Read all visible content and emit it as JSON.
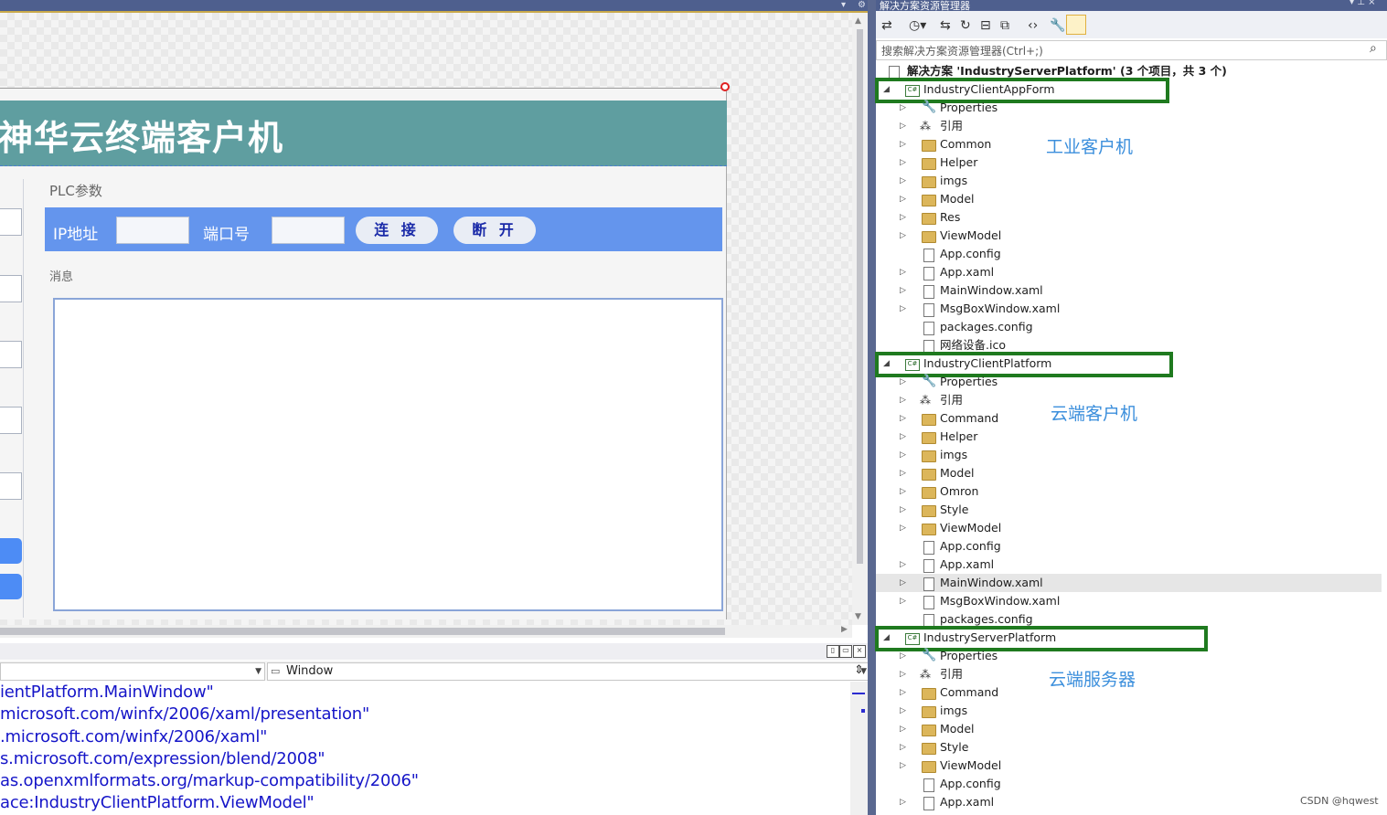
{
  "designer": {
    "app_title": "神华云终端客户机",
    "plc_label": "PLC参数",
    "ip_label": "IP地址",
    "port_label": "端口号",
    "connect_button": "连 接",
    "disconnect_button": "断 开",
    "message_label": "消息"
  },
  "xaml_pane": {
    "element_combo": "Window",
    "lines": [
      "ientPlatform.MainWindow\"",
      "microsoft.com/winfx/2006/xaml/presentation\"",
      ".microsoft.com/winfx/2006/xaml\"",
      "s.microsoft.com/expression/blend/2008\"",
      "as.openxmlformats.org/markup-compatibility/2006\"",
      "ace:IndustryClientPlatform.ViewModel\""
    ]
  },
  "solution_explorer": {
    "title": "解决方案资源管理器",
    "search_placeholder": "搜索解决方案资源管理器(Ctrl+;)",
    "solution_label": "解决方案 'IndustryServerPlatform' (3 个项目，共 3 个)",
    "projects": [
      {
        "name": "IndustryClientAppForm",
        "annotation": "工业客户机",
        "items": [
          {
            "label": "Properties",
            "icon": "wrench-icon"
          },
          {
            "label": "引用",
            "icon": "references-icon"
          },
          {
            "label": "Common",
            "icon": "folder-icon"
          },
          {
            "label": "Helper",
            "icon": "folder-icon"
          },
          {
            "label": "imgs",
            "icon": "folder-icon"
          },
          {
            "label": "Model",
            "icon": "folder-icon"
          },
          {
            "label": "Res",
            "icon": "folder-icon"
          },
          {
            "label": "ViewModel",
            "icon": "folder-icon"
          },
          {
            "label": "App.config",
            "icon": "config-file-icon"
          },
          {
            "label": "App.xaml",
            "icon": "xaml-file-icon"
          },
          {
            "label": "MainWindow.xaml",
            "icon": "xaml-file-icon"
          },
          {
            "label": "MsgBoxWindow.xaml",
            "icon": "xaml-file-icon"
          },
          {
            "label": "packages.config",
            "icon": "config-file-icon"
          },
          {
            "label": "网络设备.ico",
            "icon": "ico-file-icon"
          }
        ]
      },
      {
        "name": "IndustryClientPlatform",
        "annotation": "云端客户机",
        "items": [
          {
            "label": "Properties",
            "icon": "wrench-icon"
          },
          {
            "label": "引用",
            "icon": "references-icon"
          },
          {
            "label": "Command",
            "icon": "folder-icon"
          },
          {
            "label": "Helper",
            "icon": "folder-icon"
          },
          {
            "label": "imgs",
            "icon": "folder-icon"
          },
          {
            "label": "Model",
            "icon": "folder-icon"
          },
          {
            "label": "Omron",
            "icon": "folder-icon"
          },
          {
            "label": "Style",
            "icon": "folder-icon"
          },
          {
            "label": "ViewModel",
            "icon": "folder-icon"
          },
          {
            "label": "App.config",
            "icon": "config-file-icon"
          },
          {
            "label": "App.xaml",
            "icon": "xaml-file-icon"
          },
          {
            "label": "MainWindow.xaml",
            "icon": "xaml-file-icon"
          },
          {
            "label": "MsgBoxWindow.xaml",
            "icon": "xaml-file-icon"
          },
          {
            "label": "packages.config",
            "icon": "config-file-icon"
          }
        ]
      },
      {
        "name": "IndustryServerPlatform",
        "annotation": "云端服务器",
        "items": [
          {
            "label": "Properties",
            "icon": "wrench-icon"
          },
          {
            "label": "引用",
            "icon": "references-icon"
          },
          {
            "label": "Command",
            "icon": "folder-icon"
          },
          {
            "label": "imgs",
            "icon": "folder-icon"
          },
          {
            "label": "Model",
            "icon": "folder-icon"
          },
          {
            "label": "Style",
            "icon": "folder-icon"
          },
          {
            "label": "ViewModel",
            "icon": "folder-icon"
          },
          {
            "label": "App.config",
            "icon": "config-file-icon"
          },
          {
            "label": "App.xaml",
            "icon": "xaml-file-icon"
          }
        ]
      }
    ]
  },
  "watermark": "CSDN @hqwest"
}
